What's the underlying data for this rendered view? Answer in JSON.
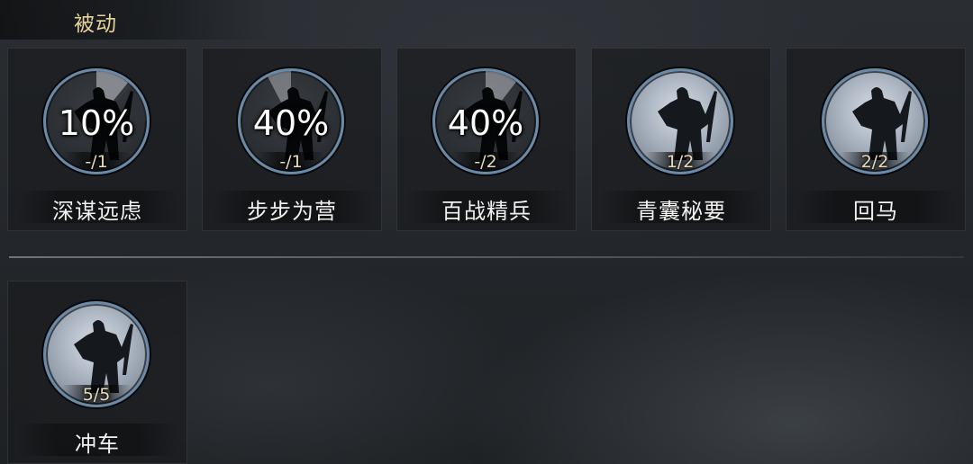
{
  "section": {
    "title": "被动"
  },
  "accent": {
    "ring": "#6b8aa8",
    "title": "#e6d39a",
    "count": "#e8dcb8"
  },
  "skills_row1": [
    {
      "name": "深谋远虑",
      "percent": "10%",
      "count": "-/1",
      "icon": "warrior-silhouette-icon",
      "locked": true
    },
    {
      "name": "步步为营",
      "percent": "40%",
      "count": "-/1",
      "icon": "warrior-silhouette-icon",
      "locked": true
    },
    {
      "name": "百战精兵",
      "percent": "40%",
      "count": "-/2",
      "icon": "warrior-silhouette-icon",
      "locked": true
    },
    {
      "name": "青囊秘要",
      "percent": "",
      "count": "1/2",
      "icon": "warrior-silhouette-icon",
      "locked": false
    },
    {
      "name": "回马",
      "percent": "",
      "count": "2/2",
      "icon": "warrior-silhouette-icon",
      "locked": false
    }
  ],
  "skills_row2": [
    {
      "name": "冲车",
      "percent": "",
      "count": "5/5",
      "icon": "warrior-silhouette-icon",
      "locked": false
    }
  ]
}
